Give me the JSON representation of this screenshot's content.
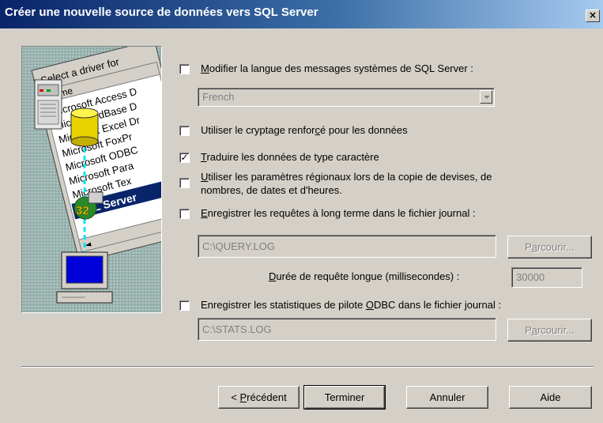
{
  "window": {
    "title": "Créer une nouvelle source de données vers SQL Server",
    "close_label": "×"
  },
  "illustration": {
    "header": "Select a driver for",
    "col_header": "Name",
    "drivers": [
      "Microsoft Access D",
      "Microsoft dBase D",
      "Microsoft Excel Dr",
      "Microsoft FoxPr",
      "Microsoft ODBC",
      "Microsoft Para",
      "Microsoft Tex"
    ],
    "selected_driver": "SQL Server",
    "badge": "32"
  },
  "options": {
    "language": {
      "pre": "",
      "ul": "M",
      "post": "odifier la langue des messages systèmes de SQL Server :",
      "checked": false,
      "dropdown_value": "French"
    },
    "encryption": {
      "pre": "Utiliser le cryptage renfor",
      "ul": "c",
      "post": "é pour les données",
      "checked": false
    },
    "translate": {
      "pre": "",
      "ul": "T",
      "post": "raduire les données de type caractère",
      "checked": true
    },
    "regional": {
      "pre": "",
      "ul": "U",
      "post": "tiliser les paramètres régionaux lors de la copie de devises, de",
      "line2": "nombres, de dates et d'heures.",
      "checked": false
    },
    "long_queries": {
      "pre": "",
      "ul": "E",
      "post": "nregistrer les requêtes à long terme dans le fichier journal :",
      "checked": false,
      "file_value": "C:\\QUERY.LOG",
      "duration_pre": "",
      "duration_ul": "D",
      "duration_post": "urée de requête longue (millisecondes) :",
      "duration_value": "30000"
    },
    "odbc_stats": {
      "pre": "Enregistrer les statistiques de pilote ",
      "ul": "O",
      "post": "DBC dans le fichier journal :",
      "checked": false,
      "file_value": "C:\\STATS.LOG"
    },
    "browse": {
      "pre": "P",
      "ul": "a",
      "post": "rcourir..."
    }
  },
  "buttons": {
    "back_pre": "< ",
    "back_ul": "P",
    "back_post": "récédent",
    "finish": "Terminer",
    "cancel": "Annuler",
    "help": "Aide"
  },
  "colors": {
    "title_start": "#0a246a",
    "title_end": "#a6caf0",
    "face": "#d4d0c8",
    "selected": "#0a246a"
  }
}
